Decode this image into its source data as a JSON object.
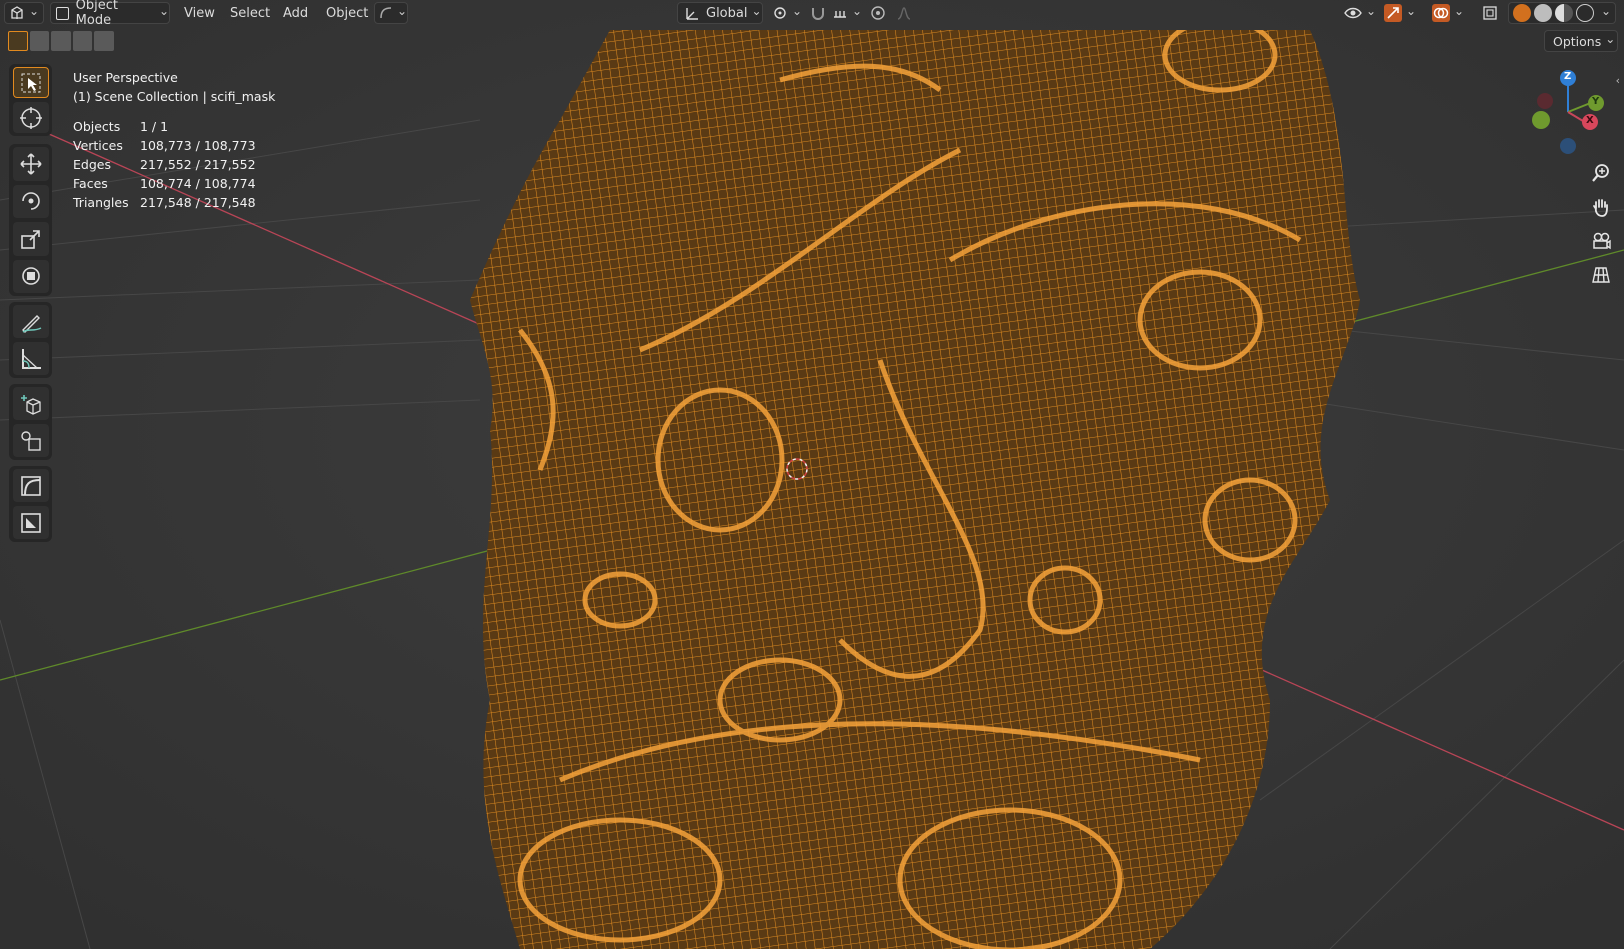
{
  "header": {
    "mode": "Object Mode",
    "menus": [
      "View",
      "Select",
      "Add",
      "Object"
    ],
    "transform_orientation": "Global",
    "options_label": "Options"
  },
  "overlay": {
    "view_name": "User Perspective",
    "collection": "(1) Scene Collection | scifi_mask",
    "stats": [
      {
        "label": "Objects",
        "value": "1 / 1"
      },
      {
        "label": "Vertices",
        "value": "108,773 / 108,773"
      },
      {
        "label": "Edges",
        "value": "217,552 / 217,552"
      },
      {
        "label": "Faces",
        "value": "108,774 / 108,774"
      },
      {
        "label": "Triangles",
        "value": "217,548 / 217,548"
      }
    ]
  },
  "gizmo": {
    "z": "Z",
    "y": "Y",
    "x": "X"
  },
  "colors": {
    "wire": "#e2902a",
    "bg": "#3a3a3a",
    "x_axis": "#c8465a",
    "y_axis": "#6f9a2e",
    "z_axis": "#2f7fd6"
  }
}
